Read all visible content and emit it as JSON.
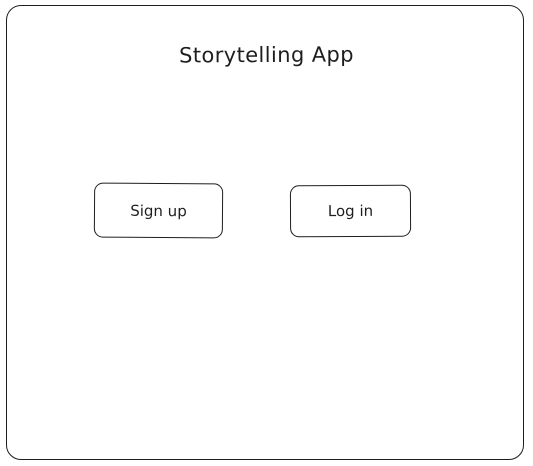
{
  "app": {
    "title": "Storytelling App"
  },
  "actions": {
    "signup_label": "Sign up",
    "login_label": "Log in"
  },
  "colors": {
    "ink": "#1e1e1e",
    "background": "#ffffff"
  }
}
